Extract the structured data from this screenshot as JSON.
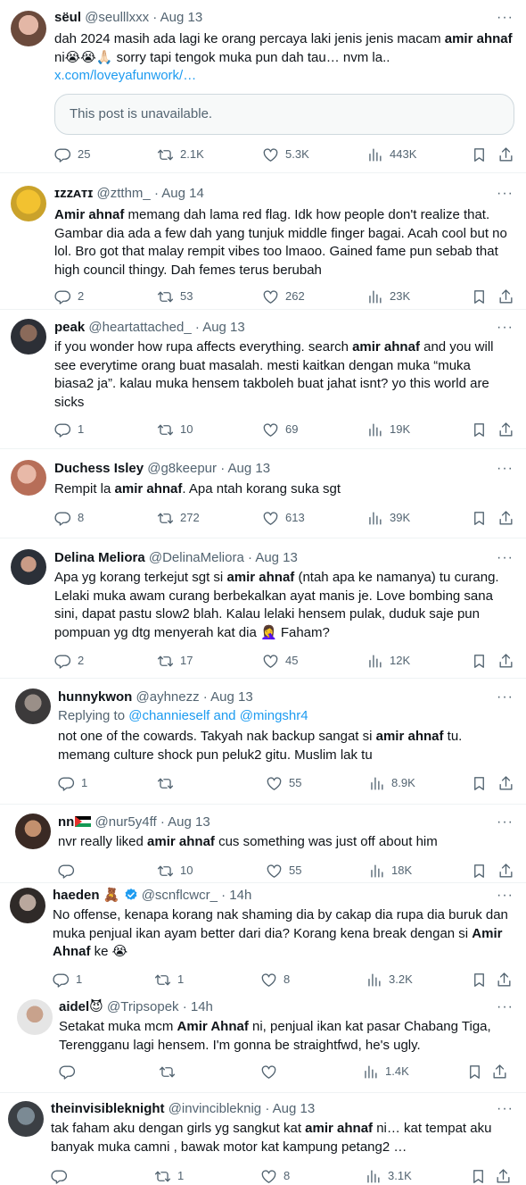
{
  "posts": [
    {
      "name": "sëul",
      "handle": "@seulllxxx",
      "sep": "·",
      "date": "Aug 13",
      "more": "···",
      "text_a": "dah 2024 masih ada lagi ke orang percaya laki jenis jenis macam ",
      "bold_a": "amir ahnaf",
      "text_b": " ni😭😭🙏🏻 sorry tapi tengok muka pun dah tau… nvm la..",
      "link": "x.com/loveyafunwork/…",
      "quote": "This post is unavailable.",
      "replies": "25",
      "reposts": "2.1K",
      "likes": "5.3K",
      "views": "443K"
    },
    {
      "name": "ɪᴢᴢᴀᴛɪ",
      "handle": "@ztthm_",
      "sep": "·",
      "date": "Aug 14",
      "more": "···",
      "bold_a": "Amir ahnaf",
      "text_a": " memang dah lama red flag. Idk how people don't realize that. Gambar dia ada a few dah yang tunjuk middle finger bagai. Acah cool but no lol. Bro got that malay rempit vibes too lmaoo. Gained fame pun sebab that high council thingy. Dah femes terus berubah",
      "replies": "2",
      "reposts": "53",
      "likes": "262",
      "views": "23K"
    },
    {
      "name": "peak",
      "handle": "@heartattached_",
      "sep": "·",
      "date": "Aug 13",
      "more": "···",
      "text_a": "if you wonder how rupa affects everything. search ",
      "bold_a": "amir ahnaf",
      "text_b": " and you will see everytime orang buat masalah. mesti kaitkan dengan muka “muka biasa2 ja”. kalau muka hensem takboleh buat jahat isnt? yo this world are sicks",
      "replies": "1",
      "reposts": "10",
      "likes": "69",
      "views": "19K"
    },
    {
      "name": "Duchess Isley",
      "handle": "@g8keepur",
      "sep": "·",
      "date": "Aug 13",
      "more": "···",
      "text_a": "Rempit la ",
      "bold_a": "amir ahnaf",
      "text_b": ". Apa ntah korang suka sgt",
      "replies": "8",
      "reposts": "272",
      "likes": "613",
      "views": "39K"
    },
    {
      "name": "Delina Meliora",
      "handle": "@DelinaMeliora",
      "sep": "·",
      "date": "Aug 13",
      "more": "···",
      "text_a": "Apa yg korang terkejut sgt si ",
      "bold_a": "amir ahnaf",
      "text_b": " (ntah apa ke namanya) tu curang. Lelaki muka awam curang berbekalkan ayat manis je. Love bombing sana sini, dapat pastu slow2 blah. Kalau lelaki hensem pulak, duduk saje pun pompuan yg dtg menyerah kat dia 🤦‍♀️ Faham?",
      "replies": "2",
      "reposts": "17",
      "likes": "45",
      "views": "12K"
    },
    {
      "name": "hunnykwon",
      "handle": "@ayhnezz",
      "sep": "·",
      "date": "Aug 13",
      "more": "···",
      "replying_prefix": "Replying to ",
      "replying_handles": "@channieself and @mingshr4",
      "text_a": "not one of the cowards. Takyah nak backup sangat si ",
      "bold_a": "amir ahnaf",
      "text_b": " tu. memang culture shock pun peluk2 gitu. Muslim lak tu",
      "replies": "1",
      "reposts": "",
      "likes": "55",
      "views": "8.9K"
    },
    {
      "name": "nn",
      "handle": "@nur5y4ff",
      "sep": "·",
      "date": "Aug 13",
      "more": "···",
      "text_a": "nvr really liked ",
      "bold_a": "amir ahnaf",
      "text_b": " cus something was just off about him",
      "replies": "",
      "reposts": "10",
      "likes": "55",
      "views": "18K"
    },
    {
      "name": "haeden 🧸",
      "handle": "@scnflcwcr_",
      "sep": "·",
      "date": "14h",
      "more": "···",
      "text_a": "No offense, kenapa korang nak shaming dia by cakap dia rupa dia buruk dan muka penjual ikan ayam better dari dia? Korang kena break dengan si ",
      "bold_a": "Amir Ahnaf",
      "text_b": " ke 😭",
      "replies": "1",
      "reposts": "1",
      "likes": "8",
      "views": "3.2K"
    },
    {
      "name": "aidel😈",
      "handle": "@Tripsopek",
      "sep": "·",
      "date": "14h",
      "more": "···",
      "text_a": "Setakat muka mcm ",
      "bold_a": "Amir Ahnaf",
      "text_b": " ni, penjual ikan kat pasar Chabang Tiga, Terengganu lagi hensem. I'm gonna be straightfwd, he's ugly.",
      "replies": "",
      "reposts": "",
      "likes": "",
      "views": "1.4K"
    },
    {
      "name": "theinvisibleknight",
      "handle": "@invincibleknig",
      "sep": "·",
      "date": "Aug 13",
      "more": "···",
      "text_a": "tak faham aku dengan girls yg sangkut kat ",
      "bold_a": "amir ahnaf",
      "text_b": " ni… kat tempat aku banyak muka camni , bawak motor kat kampung petang2 …",
      "replies": "",
      "reposts": "1",
      "likes": "8",
      "views": "3.1K"
    }
  ]
}
